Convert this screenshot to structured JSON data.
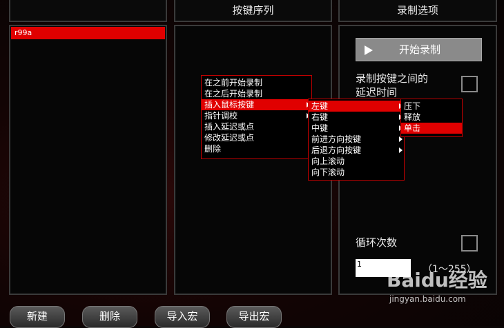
{
  "headers": {
    "key_sequence": "按键序列",
    "record_options": "录制选项"
  },
  "macro_list": {
    "items": [
      {
        "label": "r99a",
        "selected": true
      }
    ]
  },
  "context_menu": {
    "items": [
      {
        "label": "在之前开始录制"
      },
      {
        "label": "在之后开始录制"
      },
      {
        "label": "插入鼠标按键",
        "highlighted": true,
        "submenu": true
      },
      {
        "label": "指针调校",
        "submenu": true
      },
      {
        "label": "插入延迟或点"
      },
      {
        "label": "修改延迟或点"
      },
      {
        "label": "删除"
      }
    ]
  },
  "mouse_submenu": {
    "items": [
      {
        "label": "左键",
        "highlighted": true,
        "submenu": true
      },
      {
        "label": "右键",
        "submenu": true
      },
      {
        "label": "中键",
        "submenu": true
      },
      {
        "label": "前进方向按键",
        "submenu": true
      },
      {
        "label": "后退方向按键",
        "submenu": true
      },
      {
        "label": "向上滚动"
      },
      {
        "label": "向下滚动"
      }
    ]
  },
  "action_submenu": {
    "items": [
      {
        "label": "压下"
      },
      {
        "label": "释放"
      },
      {
        "label": "单击",
        "highlighted": true
      }
    ]
  },
  "record_options": {
    "start_button": "开始录制",
    "delay_label_line1": "录制按键之间的",
    "delay_label_line2": "延迟时间",
    "delay_checked": false,
    "loop_label": "循环次数",
    "loop_checked": false,
    "loop_value": "1",
    "loop_range": "（1～255）"
  },
  "bottom_buttons": {
    "new": "新建",
    "delete": "删除",
    "import": "导入宏",
    "export": "导出宏"
  },
  "watermark": {
    "logo": "Baidu经验",
    "url": "jingyan.baidu.com"
  },
  "colors": {
    "accent": "#e00000",
    "menu_border": "#c00000",
    "record_button": "#8a8a8a"
  }
}
